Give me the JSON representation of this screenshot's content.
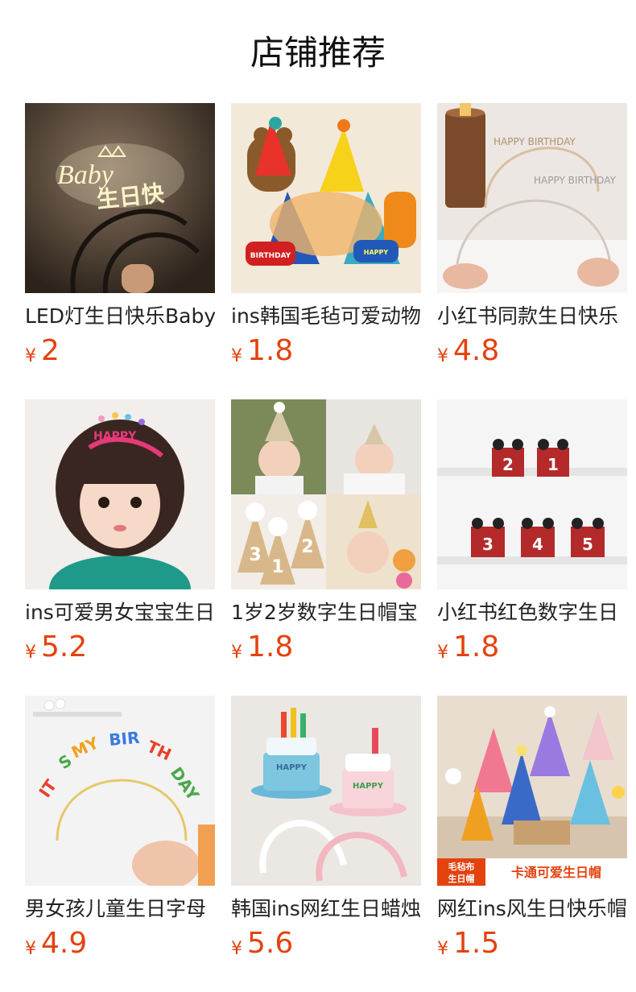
{
  "page": {
    "title": "店铺推荐"
  },
  "currency_symbol": "¥",
  "products": [
    {
      "name": "LED灯生日快乐Baby",
      "price": "2",
      "image_text": "Baby 生日快乐",
      "image_icon": "led-headband-image"
    },
    {
      "name": "ins韩国毛毡可爱动物",
      "price": "1.8",
      "image_text": "HAPPY BIRTHDAY",
      "image_icon": "felt-animal-hat-image"
    },
    {
      "name": "小红书同款生日快乐",
      "price": "4.8",
      "image_text": "HAPPY BIRTHDAY",
      "image_icon": "rhinestone-headband-image"
    },
    {
      "name": "ins可爱男女宝宝生日",
      "price": "5.2",
      "image_text": "HAPPY BIRTHDAY",
      "image_icon": "girl-crown-headband-image"
    },
    {
      "name": "1岁2岁数字生日帽宝",
      "price": "1.8",
      "image_text": "",
      "image_icon": "baby-number-hat-image"
    },
    {
      "name": "小红书红色数字生日",
      "price": "1.8",
      "image_text": "",
      "image_icon": "red-number-crown-image"
    },
    {
      "name": "男女孩儿童生日字母",
      "price": "4.9",
      "image_text": "ITS MY BIRTHDAY",
      "image_icon": "letter-headband-image"
    },
    {
      "name": "韩国ins网红生日蜡烛",
      "price": "5.6",
      "image_text": "HAPPY BIRTHDAY",
      "image_icon": "cake-hat-headband-image"
    },
    {
      "name": "网红ins风生日快乐帽",
      "price": "1.5",
      "image_text": "毛毡布 生日帽 卡通可爱生日帽",
      "image_icon": "cartoon-party-hat-image"
    }
  ],
  "colors": {
    "price": "#e4420e",
    "title": "#111111",
    "name": "#222222"
  }
}
